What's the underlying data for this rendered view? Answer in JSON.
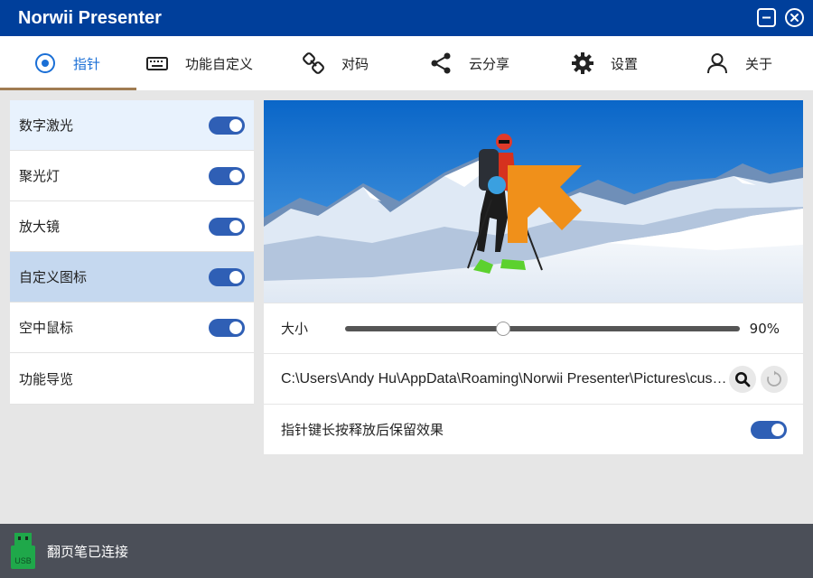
{
  "app": {
    "title": "Norwii Presenter"
  },
  "tabs": [
    {
      "label": "指针",
      "icon": "pointer-icon",
      "active": true
    },
    {
      "label": "功能自定义",
      "icon": "keyboard-icon"
    },
    {
      "label": "对码",
      "icon": "link-icon"
    },
    {
      "label": "云分享",
      "icon": "share-icon"
    },
    {
      "label": "设置",
      "icon": "gear-icon"
    },
    {
      "label": "关于",
      "icon": "user-icon"
    }
  ],
  "sidebar": {
    "items": [
      {
        "label": "数字激光",
        "toggle": true
      },
      {
        "label": "聚光灯",
        "toggle": true
      },
      {
        "label": "放大镜",
        "toggle": true
      },
      {
        "label": "自定义图标",
        "toggle": true,
        "selected": true
      },
      {
        "label": "空中鼠标",
        "toggle": true
      },
      {
        "label": "功能导览"
      }
    ]
  },
  "settings": {
    "size_label": "大小",
    "size_value": "90%",
    "size_fraction": 0.4,
    "path": "C:\\Users\\Andy Hu\\AppData\\Roaming\\Norwii Presenter\\Pictures\\custom.png",
    "keep_label": "指针键长按释放后保留效果",
    "keep_enabled": true
  },
  "status": {
    "text": "翻页笔已连接",
    "usb_label": "USB"
  },
  "colors": {
    "titlebar": "#003f9b",
    "accent": "#2f5fb5",
    "arrow": "#f0901a",
    "statusbar": "#4b4f58"
  }
}
